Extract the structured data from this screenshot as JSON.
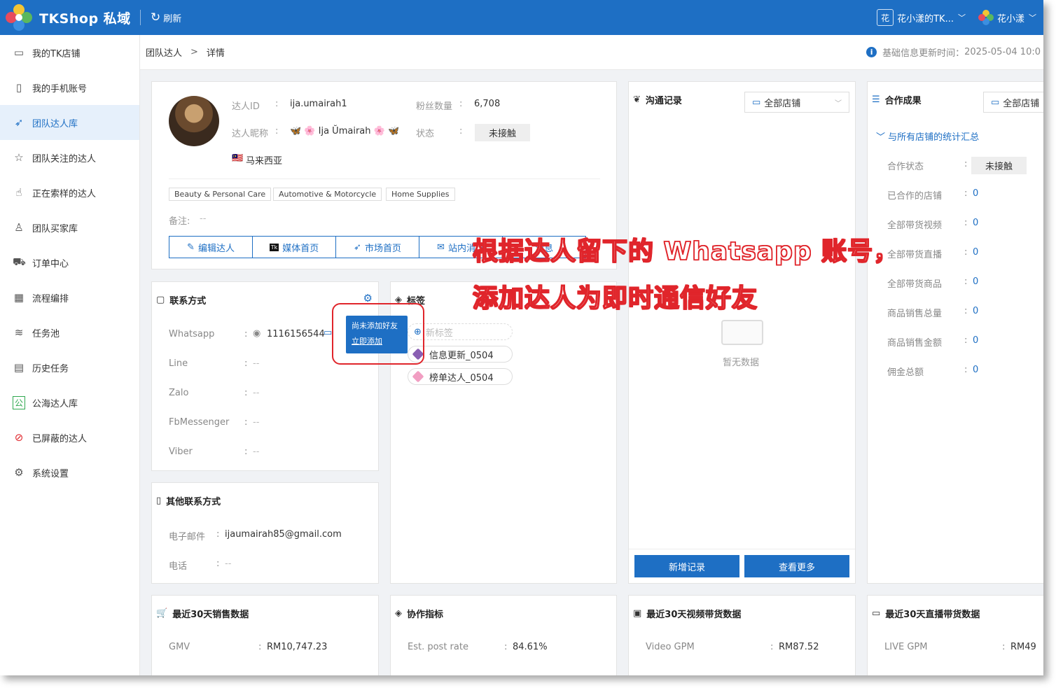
{
  "header": {
    "app_title": "TKShop 私域",
    "refresh_label": "刷新",
    "shop_badge": "花",
    "shop_name": "花小漾的TK...",
    "user_name": "花小漾"
  },
  "sidebar": {
    "items": [
      {
        "label": "我的TK店铺",
        "icon": "▭"
      },
      {
        "label": "我的手机账号",
        "icon": "▯"
      },
      {
        "label": "团队达人库",
        "icon": "➶"
      },
      {
        "label": "团队关注的达人",
        "icon": "☆"
      },
      {
        "label": "正在索样的达人",
        "icon": "☝"
      },
      {
        "label": "团队买家库",
        "icon": "♙"
      },
      {
        "label": "订单中心",
        "icon": "⛟"
      },
      {
        "label": "流程编排",
        "icon": "▦"
      },
      {
        "label": "任务池",
        "icon": "≋"
      },
      {
        "label": "历史任务",
        "icon": "▤"
      },
      {
        "label": "公海达人库",
        "icon": "公"
      },
      {
        "label": "已屏蔽的达人",
        "icon": "⊘"
      },
      {
        "label": "系统设置",
        "icon": "⚙"
      }
    ]
  },
  "breadcrumb": {
    "parent": "团队达人",
    "current": "详情",
    "update_label": "基础信息更新时间：",
    "update_time": "2025-05-04 10:0"
  },
  "profile": {
    "id_label": "达人ID",
    "id_value": "ija.umairah1",
    "fans_label": "粉丝数量",
    "fans_value": "6,708",
    "nick_label": "达人昵称",
    "nick_value": "🦋 🌸 Ija Ŭmairah 🌸 🦋",
    "status_label": "状态",
    "status_value": "未接触",
    "country": "马来西亚",
    "categories": [
      "Beauty & Personal Care",
      "Automotive & Motorcycle",
      "Home Supplies"
    ],
    "remark_label": "备注:",
    "remark_value": "--",
    "actions": [
      "编辑达人",
      "媒体首页",
      "市场首页",
      "站内消息",
      "消息"
    ]
  },
  "contact": {
    "title": "联系方式",
    "rows": [
      {
        "label": "Whatsapp",
        "value": "1116156544"
      },
      {
        "label": "Line",
        "value": "--"
      },
      {
        "label": "Zalo",
        "value": "--"
      },
      {
        "label": "FbMessenger",
        "value": "--"
      },
      {
        "label": "Viber",
        "value": "--"
      }
    ],
    "tooltip_text": "尚未添加好友",
    "tooltip_link": "立即添加"
  },
  "labels": {
    "title": "标签",
    "new_placeholder": "新标签",
    "items": [
      {
        "name": "信息更新_0504",
        "color": "#8a5fb3"
      },
      {
        "name": "榜单达人_0504",
        "color": "#f19ec2"
      }
    ]
  },
  "other_contact": {
    "title": "其他联系方式",
    "email_label": "电子邮件",
    "email_value": "ijaumairah85@gmail.com",
    "phone_label": "电话",
    "phone_value": "--"
  },
  "comm": {
    "title": "沟通记录",
    "shop_select": "全部店铺",
    "empty_text": "暂无数据",
    "add_button": "新增记录",
    "more_button": "查看更多"
  },
  "coop": {
    "title": "合作成果",
    "shop_select": "全部店铺",
    "summary_toggle": "与所有店铺的统计汇总",
    "status_label": "合作状态",
    "status_value": "未接触",
    "rows": [
      {
        "label": "已合作的店铺",
        "value": "0"
      },
      {
        "label": "全部带货视频",
        "value": "0"
      },
      {
        "label": "全部带货直播",
        "value": "0"
      },
      {
        "label": "全部带货商品",
        "value": "0"
      },
      {
        "label": "商品销售总量",
        "value": "0"
      },
      {
        "label": "商品销售金额",
        "value": "0"
      },
      {
        "label": "佣金总额",
        "value": "0"
      }
    ]
  },
  "bottom": {
    "sales": {
      "title": "最近30天销售数据",
      "label": "GMV",
      "value": "RM10,747.23"
    },
    "collab": {
      "title": "协作指标",
      "label": "Est. post rate",
      "value": "84.61%"
    },
    "video": {
      "title": "最近30天视频带货数据",
      "label": "Video GPM",
      "value": "RM87.52"
    },
    "live": {
      "title": "最近30天直播带货数据",
      "label": "LIVE GPM",
      "value": "RM49"
    }
  },
  "annotation": {
    "line1": "根据达人留下的 Whatsapp 账号，",
    "line2": "添加达人为即时通信好友"
  }
}
